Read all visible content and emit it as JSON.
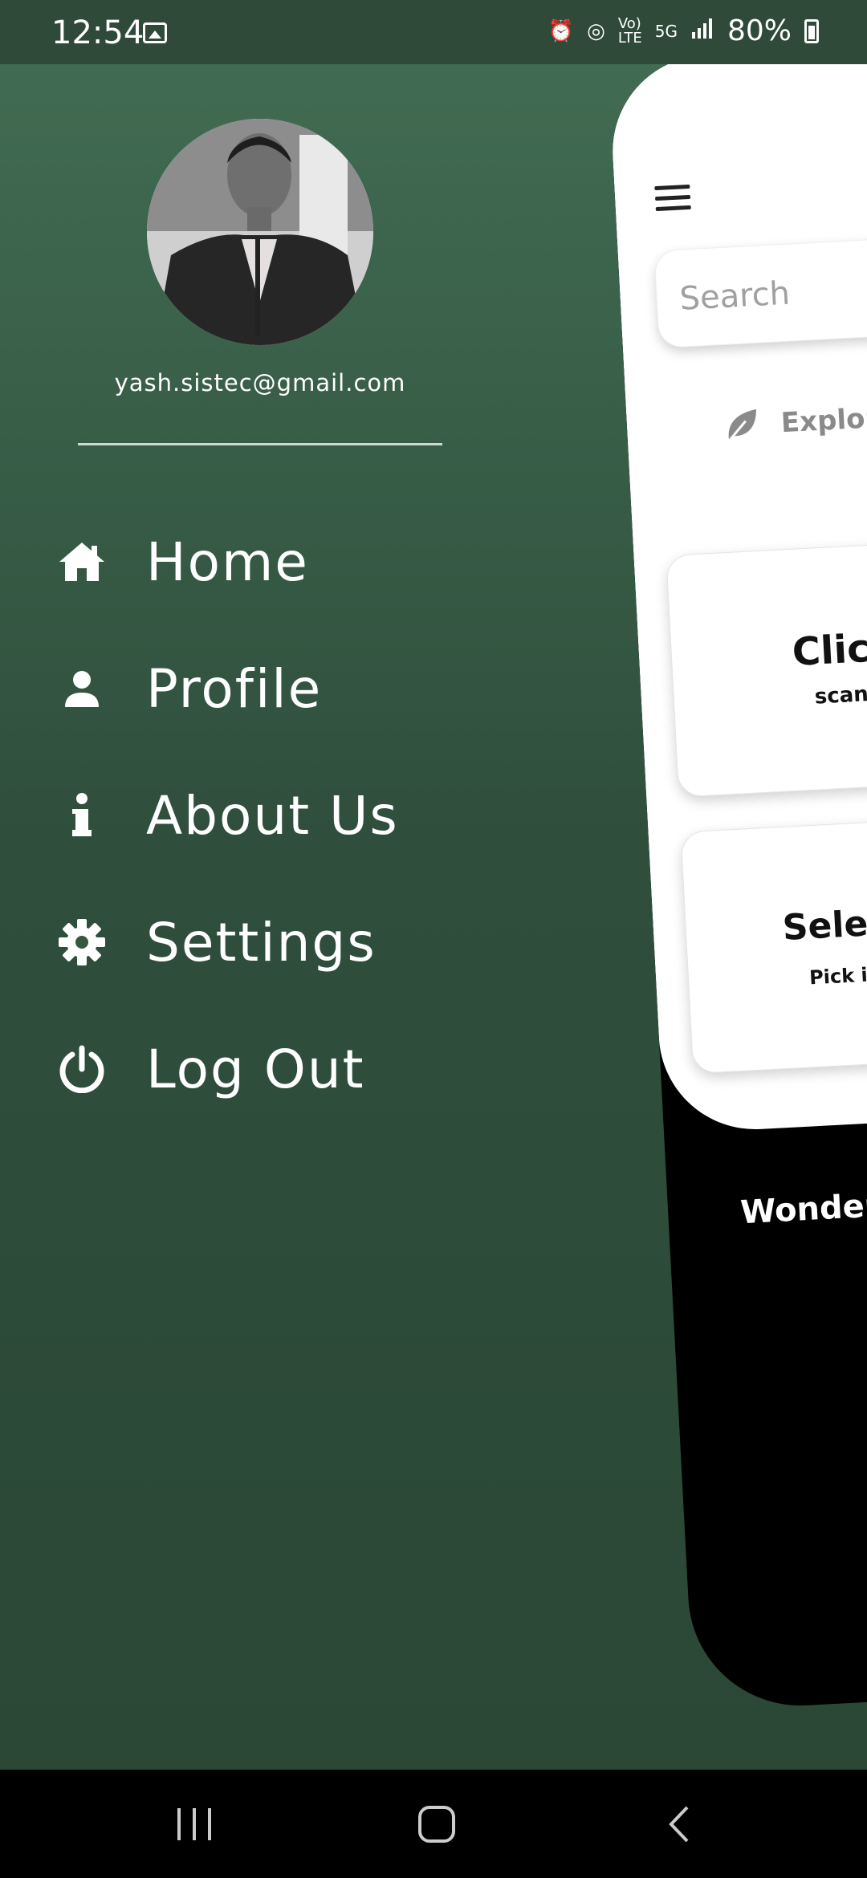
{
  "status_bar": {
    "time": "12:54",
    "battery": "80%",
    "icons": [
      "image-icon",
      "alarm-icon",
      "hotspot-icon",
      "volte-icon",
      "5g-icon",
      "signal-icon",
      "battery-icon"
    ]
  },
  "drawer": {
    "email": "yash.sistec@gmail.com",
    "menu": [
      {
        "label": "Home",
        "icon": "home-icon"
      },
      {
        "label": "Profile",
        "icon": "person-icon"
      },
      {
        "label": "About Us",
        "icon": "info-icon"
      },
      {
        "label": "Settings",
        "icon": "gear-icon"
      },
      {
        "label": "Log Out",
        "icon": "power-icon"
      }
    ]
  },
  "main": {
    "search_placeholder": "Search",
    "explore_text": "Explore F",
    "card1": {
      "title": "Click",
      "subtitle": "scan yo"
    },
    "card2": {
      "title": "Select",
      "subtitle": "Pick imag"
    },
    "bottom_text": "Wondering"
  },
  "colors": {
    "drawer_top": "#416b52",
    "drawer_bottom": "#2b4736",
    "statusbar": "#2f4a39"
  }
}
